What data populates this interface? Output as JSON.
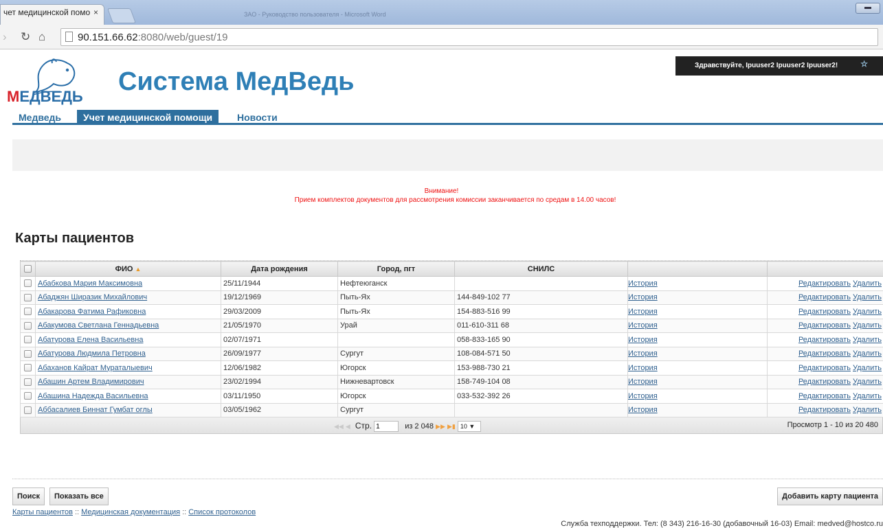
{
  "browser": {
    "tab_title": "чет медицинской помо",
    "tab_close": "×",
    "background_window_title": "ЗАО - Руководство пользователя - Microsoft Word",
    "url_host": "90.151.66.62",
    "url_rest": ":8080/web/guest/19"
  },
  "header": {
    "logo_text_red": "М",
    "logo_text_blue": "ЕДВЕДЬ",
    "site_title": "Система МедВедь",
    "user_greeting": "Здравствуйте, Ipuuser2 Ipuuser2 Ipuuser2!"
  },
  "menu": {
    "items": [
      "Медведь",
      "Учет медицинской помощи",
      "Новости"
    ]
  },
  "notice": {
    "line1": "Внимание!",
    "line2": "Прием комплектов документов для рассмотрения комиссии заканчивается по средам в 14.00 часов!"
  },
  "section_title": "Карты пациентов",
  "table": {
    "headers": [
      "ФИО",
      "Дата рождения",
      "Город, пгт",
      "СНИЛС",
      "",
      ""
    ],
    "rows": [
      {
        "name": "Абабкова Мария Максимовна",
        "dob": "25/11/1944",
        "city": "Нефтеюганск",
        "snils": ""
      },
      {
        "name": "Абаджян Ширазик Михайлович",
        "dob": "19/12/1969",
        "city": "Пыть-Ях",
        "snils": "144-849-102 77"
      },
      {
        "name": "Абакарова Фатима Рафиковна",
        "dob": "29/03/2009",
        "city": "Пыть-Ях",
        "snils": "154-883-516 99"
      },
      {
        "name": "Абакумова Светлана Геннадьевна",
        "dob": "21/05/1970",
        "city": "Урай",
        "snils": "011-610-311 68"
      },
      {
        "name": "Абатурова Елена Васильевна",
        "dob": "02/07/1971",
        "city": "",
        "snils": "058-833-165 90"
      },
      {
        "name": "Абатурова Людмила Петровна",
        "dob": "26/09/1977",
        "city": "Сургут",
        "snils": "108-084-571 50"
      },
      {
        "name": "Абаханов Кайрат Мураталыевич",
        "dob": "12/06/1982",
        "city": "Югорск",
        "snils": "153-988-730 21"
      },
      {
        "name": "Абашин Артем Владимирович",
        "dob": "23/02/1994",
        "city": "Нижневартовск",
        "snils": "158-749-104 08"
      },
      {
        "name": "Абашина Надежда Васильевна",
        "dob": "03/11/1950",
        "city": "Югорск",
        "snils": "033-532-392 26"
      },
      {
        "name": "Аббасалиев Биннат Гумбат оглы",
        "dob": "03/05/1962",
        "city": "Сургут",
        "snils": ""
      }
    ],
    "history_label": "История",
    "edit_label": "Редактировать",
    "delete_label": "Удалить"
  },
  "pager": {
    "page_label": "Стр.",
    "page_value": "1",
    "of_label": "из 2 048",
    "per_page": "10",
    "view_summary": "Просмотр 1 - 10 из 20 480"
  },
  "buttons": {
    "search": "Поиск",
    "show_all": "Показать все",
    "add_card": "Добавить карту пациента"
  },
  "footer": {
    "links": [
      "Карты пациентов",
      "Медицинская документация",
      "Список протоколов"
    ],
    "link_separator": "::",
    "support": "Служба техподдержки. Тел: (8 343) 216-16-30 (добавочный 16-03) Email: medved@hostco.ru"
  }
}
